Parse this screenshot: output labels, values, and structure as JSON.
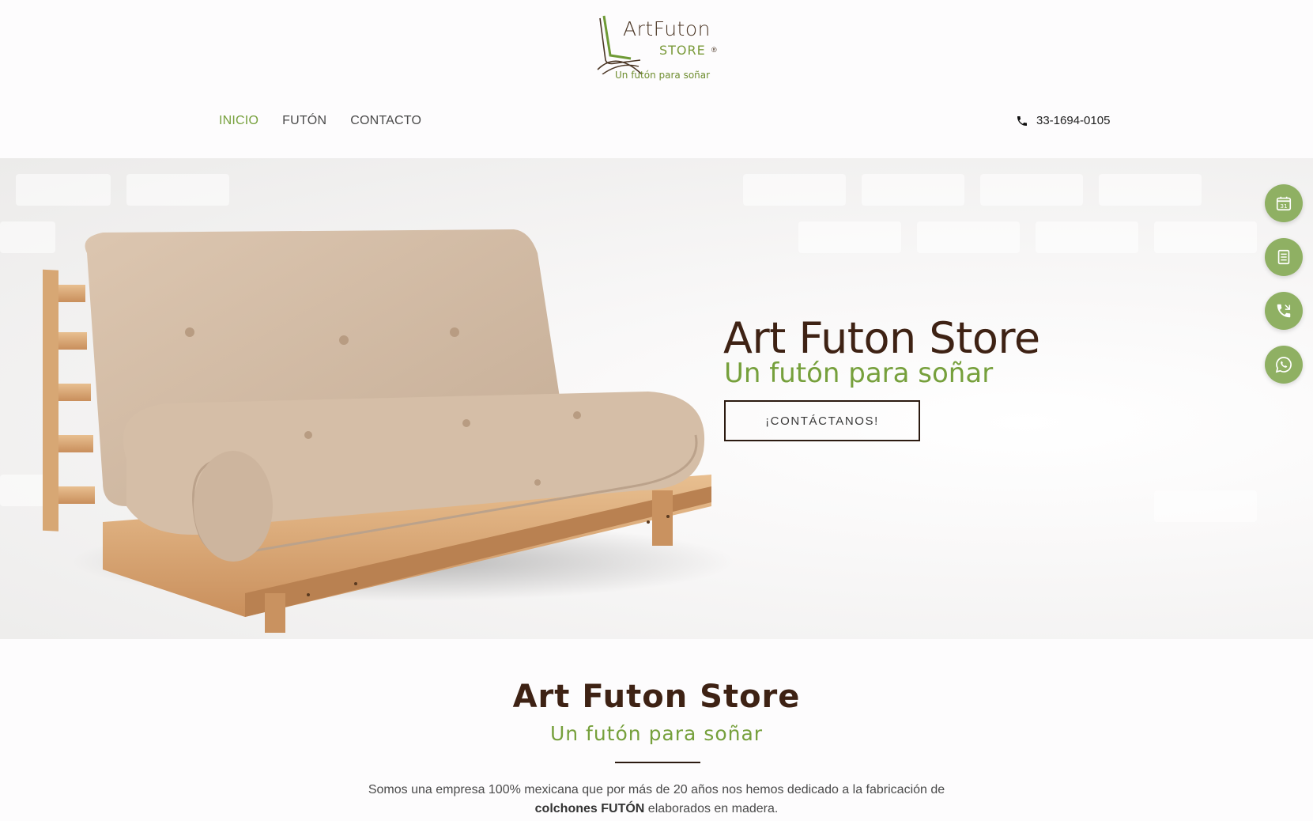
{
  "logo": {
    "word": "ArtFuton",
    "store": "STORE",
    "reg": "®",
    "tagline": "Un futón para soñar"
  },
  "nav": {
    "items": [
      {
        "label": "INICIO",
        "active": true
      },
      {
        "label": "FUTÓN",
        "active": false
      },
      {
        "label": "CONTACTO",
        "active": false
      }
    ]
  },
  "header": {
    "phone": "33-1694-0105",
    "phone_icon": "phone-icon"
  },
  "hero": {
    "title": "Art Futon Store",
    "subtitle": "Un futón para soñar",
    "cta_label": "¡CONTÁCTANOS!",
    "calendar_day": "31"
  },
  "side_buttons": [
    {
      "icon": "calendar-icon"
    },
    {
      "icon": "document-icon"
    },
    {
      "icon": "phone-call-icon"
    },
    {
      "icon": "whatsapp-icon"
    }
  ],
  "about": {
    "title": "Art Futon Store",
    "subtitle": "Un futón para soñar",
    "text_line1": "Somos una empresa 100% mexicana que por más de 20 años nos hemos dedicado a la fabricación de",
    "text_bold": "colchones FUTÓN",
    "text_line2_rest": " elaborados en madera."
  },
  "colors": {
    "brand_brown": "#3e2214",
    "brand_green": "#76a03c",
    "side_button_green": "#8fb063"
  }
}
